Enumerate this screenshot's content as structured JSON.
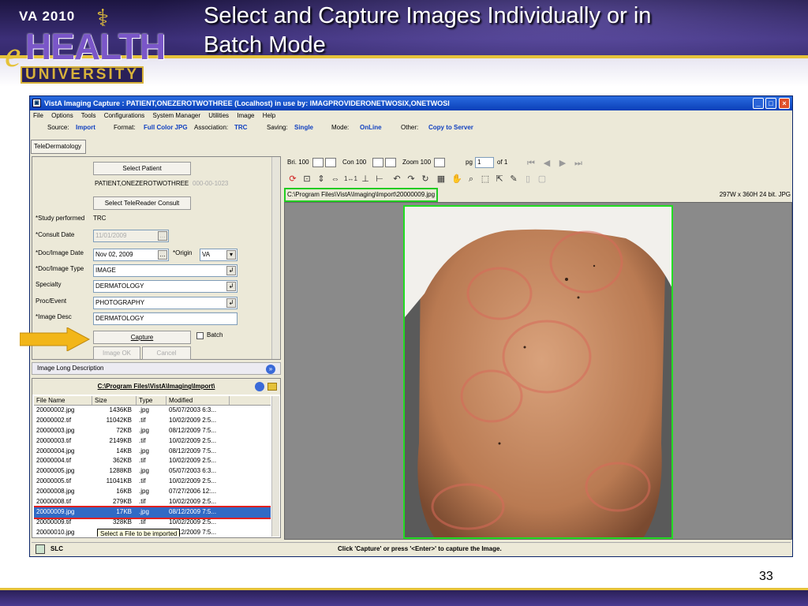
{
  "slide": {
    "title_line1": "Select and Capture Images Individually or in",
    "title_line2": "Batch Mode",
    "page_number": "33",
    "logo": {
      "top": "VA 2010",
      "e": "e",
      "main": "HEALTH",
      "bottom": "UNIVERSITY"
    }
  },
  "window": {
    "title": "VistA Imaging Capture : PATIENT,ONEZEROTWOTHREE (Localhost)  in use by: IMAGPROVIDERONETWOSIX,ONETWOSI",
    "menu": [
      "File",
      "Options",
      "Tools",
      "Configurations",
      "System Manager",
      "Utilities",
      "Image",
      "Help"
    ]
  },
  "infobar": {
    "source_label": "Source:",
    "source": "Import",
    "format_label": "Format:",
    "format": "Full Color JPG",
    "association_label": "Association:",
    "association": "TRC",
    "saving_label": "Saving:",
    "saving": "Single",
    "mode_label": "Mode:",
    "mode": "OnLine",
    "other_label": "Other:",
    "other": "Copy to Server"
  },
  "tab": "TeleDermatology",
  "form": {
    "select_patient": "Select Patient",
    "patient_name": "PATIENT,ONEZEROTWOTHREE",
    "patient_id": "000-00-1023",
    "select_consult": "Select TeleReader Consult",
    "study_label": "*Study performed",
    "study_value": "TRC",
    "consult_date_label": "*Consult Date",
    "consult_date": "11/01/2009",
    "doc_date_label": "*Doc/Image Date",
    "doc_date": "Nov 02, 2009",
    "origin_label": "*Origin",
    "origin": "VA",
    "doc_type_label": "*Doc/Image Type",
    "doc_type": "IMAGE",
    "specialty_label": "Specialty",
    "specialty": "DERMATOLOGY",
    "proc_label": "Proc/Event",
    "proc": "PHOTOGRAPHY",
    "desc_label": "*Image Desc",
    "desc": "DERMATOLOGY",
    "capture": "Capture",
    "batch": "Batch",
    "image_ok": "Image OK",
    "cancel": "Cancel"
  },
  "long_desc": "Image Long Description",
  "files": {
    "directory": "C:\\Program Files\\VistA\\Imaging\\Import\\",
    "headers": [
      "File Name",
      "Size",
      "Type",
      "Modified"
    ],
    "rows": [
      [
        "20000002.jpg",
        "1436KB",
        ".jpg",
        "05/07/2003 6:3..."
      ],
      [
        "20000002.tif",
        "11042KB",
        ".tif",
        "10/02/2009 2:5..."
      ],
      [
        "20000003.jpg",
        "72KB",
        ".jpg",
        "08/12/2009 7:5..."
      ],
      [
        "20000003.tif",
        "2149KB",
        ".tif",
        "10/02/2009 2:5..."
      ],
      [
        "20000004.jpg",
        "14KB",
        ".jpg",
        "08/12/2009 7:5..."
      ],
      [
        "20000004.tif",
        "362KB",
        ".tif",
        "10/02/2009 2:5..."
      ],
      [
        "20000005.jpg",
        "1288KB",
        ".jpg",
        "05/07/2003 6:3..."
      ],
      [
        "20000005.tif",
        "11041KB",
        ".tif",
        "10/02/2009 2:5..."
      ],
      [
        "20000008.jpg",
        "16KB",
        ".jpg",
        "07/27/2006 12:..."
      ],
      [
        "20000008.tif",
        "279KB",
        ".tif",
        "10/02/2009 2:5..."
      ],
      [
        "20000009.jpg",
        "17KB",
        ".jpg",
        "08/12/2009 7:5..."
      ],
      [
        "20000009.tif",
        "328KB",
        ".tif",
        "10/02/2009 2:5..."
      ],
      [
        "20000010.jpg",
        "",
        "",
        "08/12/2009 7:5..."
      ]
    ],
    "selected_index": 10,
    "tooltip": "Select a File to be imported"
  },
  "viewer": {
    "bri_label": "Bri. 100",
    "con_label": "Con  100",
    "zoom_label": "Zoom 100",
    "pg_label": "pg",
    "pg_value": "1",
    "of_label": "of 1",
    "path": "C:\\Program Files\\VistA\\Imaging\\Import\\20000009.jpg",
    "dims": "297W x 360H  24 bit.  JPG"
  },
  "status": {
    "location": "SLC",
    "message": "Click 'Capture' or press '<Enter>' to capture the Image."
  },
  "colors": {
    "accent": "#e5c23a",
    "title_bar": "#0a3fb8",
    "selection": "#316ac5",
    "highlight": "#22dd22",
    "callout_arrow": "#f2b619"
  }
}
